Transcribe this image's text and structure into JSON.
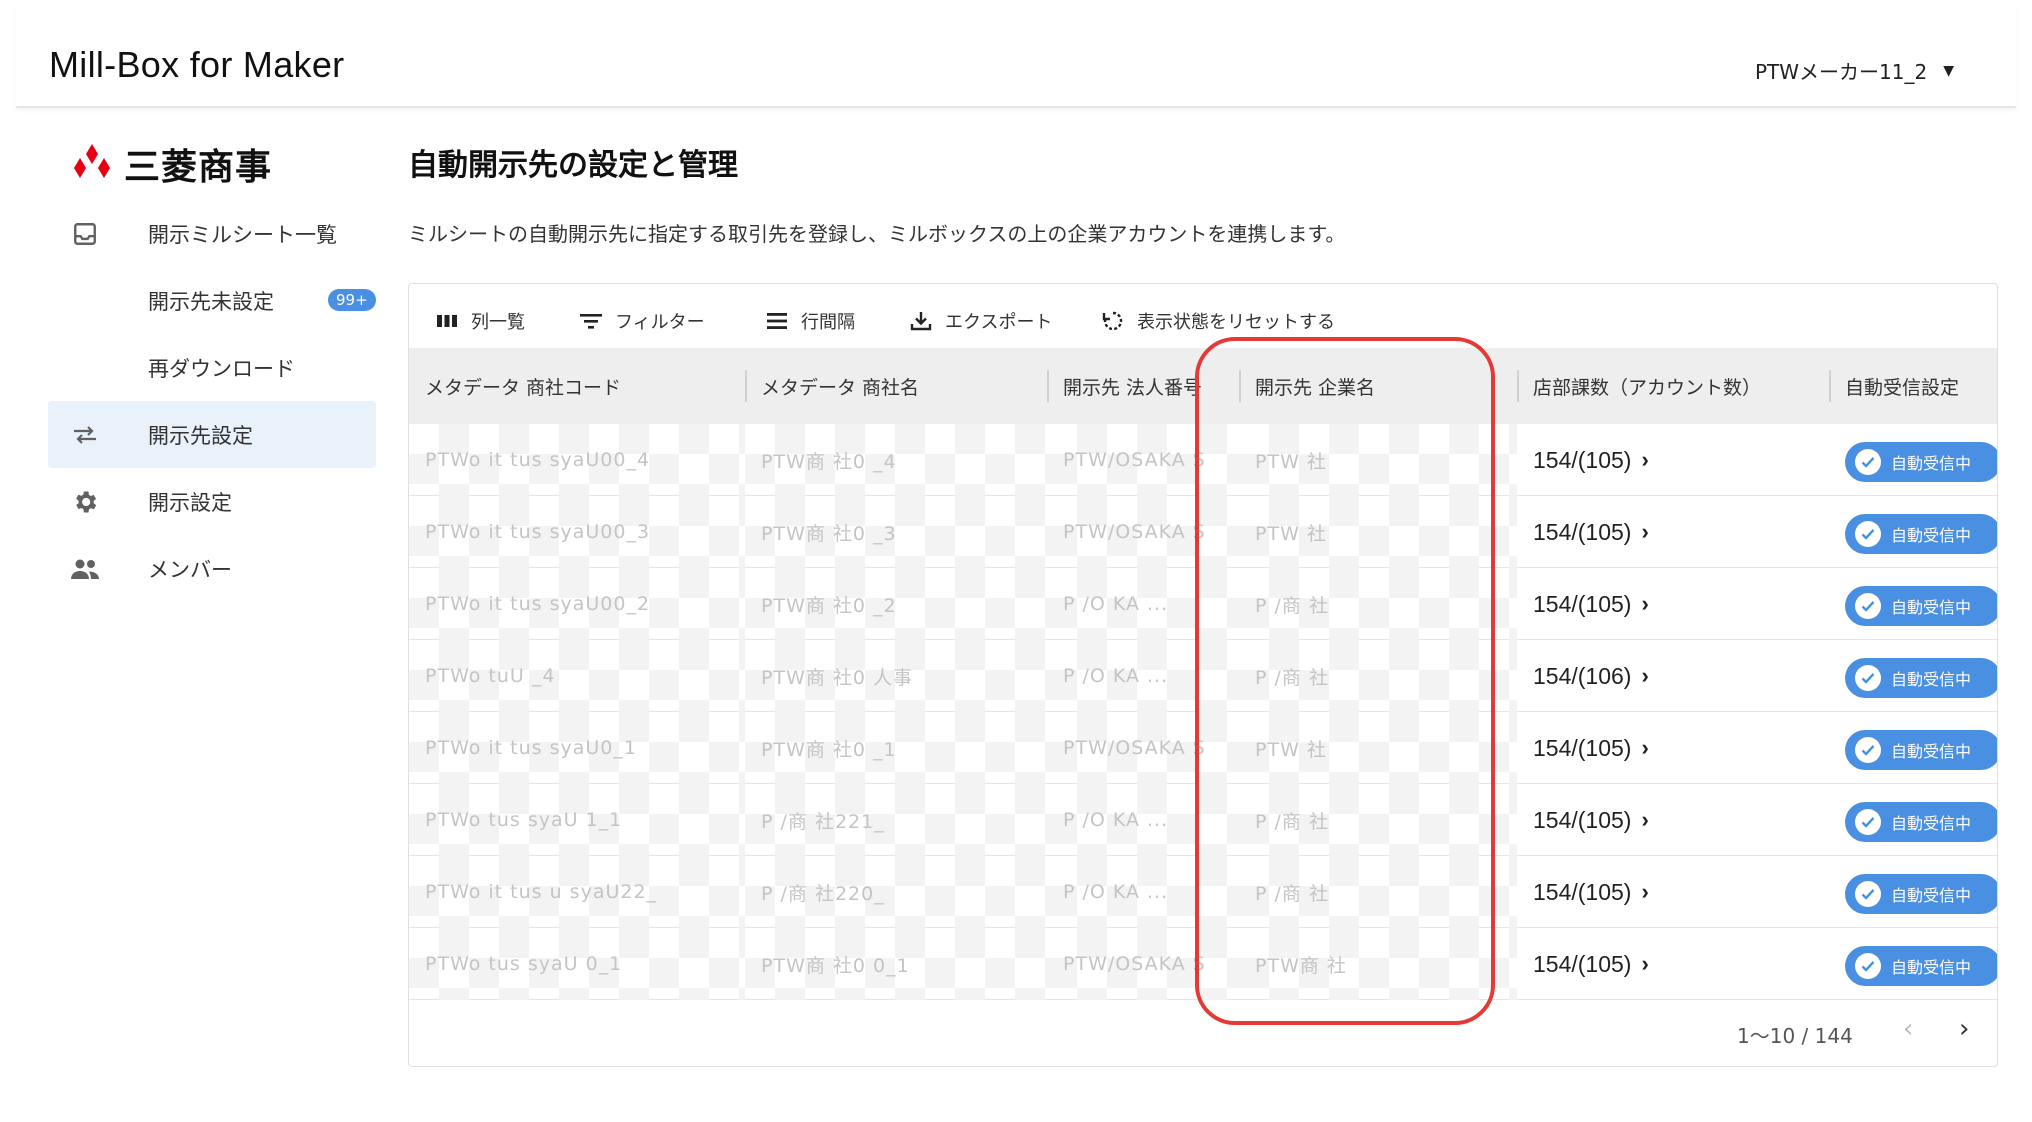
{
  "app": {
    "title": "Mill-Box for Maker",
    "account": "PTWメーカー11_2"
  },
  "sidebar": {
    "brand": "三菱商事",
    "items": [
      {
        "label": "開示ミルシート一覧",
        "icon": "inbox-icon"
      },
      {
        "label": "開示先未設定",
        "badge": "99+"
      },
      {
        "label": "再ダウンロード"
      },
      {
        "label": "開示先設定",
        "icon": "swap-arrows-icon",
        "active": true
      },
      {
        "label": "開示設定",
        "icon": "gear-icon"
      },
      {
        "label": "メンバー",
        "icon": "people-icon"
      }
    ]
  },
  "main": {
    "title": "自動開示先の設定と管理",
    "description": "ミルシートの自動開示先に指定する取引先を登録し、ミルボックスの上の企業アカウントを連携します。"
  },
  "toolbar": {
    "columns": "列一覧",
    "filter": "フィルター",
    "density": "行間隔",
    "export": "エクスポート",
    "reset": "表示状態をリセットする"
  },
  "table": {
    "headers": [
      "メタデータ 商社コード",
      "メタデータ 商社名",
      "開示先 法人番号",
      "開示先 企業名",
      "店部課数（アカウント数）",
      "自動受信設定"
    ],
    "rows": [
      {
        "code": "PTWo  it tus   syaU00_4",
        "name": "PTW商 社0  _4",
        "corp_no": "PTW/OSAKA S",
        "company": "PTW  社",
        "count": "154/(105)",
        "status": "自動受信中"
      },
      {
        "code": "PTWo  it tus   syaU00_3",
        "name": "PTW商 社0  _3",
        "corp_no": "PTW/OSAKA S",
        "company": "PTW  社",
        "count": "154/(105)",
        "status": "自動受信中"
      },
      {
        "code": "PTWo  it tus   syaU00_2",
        "name": "PTW商 社0  _2",
        "corp_no": "P  /O  KA ...",
        "company": "P  /商 社",
        "count": "154/(105)",
        "status": "自動受信中"
      },
      {
        "code": "PTWo    tuU   _4",
        "name": "PTW商 社0   人事",
        "corp_no": "P  /O  KA ...",
        "company": "P  /商 社",
        "count": "154/(106)",
        "status": "自動受信中"
      },
      {
        "code": "PTWo  it tus   syaU0_1",
        "name": "PTW商 社0  _1",
        "corp_no": "PTW/OSAKA S",
        "company": "PTW  社",
        "count": "154/(105)",
        "status": "自動受信中"
      },
      {
        "code": "PTWo    tus   syaU 1_1",
        "name": "P  /商 社221_",
        "corp_no": "P  /O  KA ...",
        "company": "P  /商 社",
        "count": "154/(105)",
        "status": "自動受信中"
      },
      {
        "code": "PTWo  it tus  u syaU22_",
        "name": "P  /商 社220_",
        "corp_no": "P  /O  KA ...",
        "company": "P  /商 社",
        "count": "154/(105)",
        "status": "自動受信中"
      },
      {
        "code": "PTWo    tus   syaU  0_1",
        "name": "PTW商 社0  0_1",
        "corp_no": "PTW/OSAKA S",
        "company": "PTW商 社",
        "count": "154/(105)",
        "status": "自動受信中"
      }
    ]
  },
  "pagination": {
    "range": "1〜10 / 144",
    "prev": "‹",
    "next": "›"
  },
  "colors": {
    "accent": "#4a90e2",
    "highlight": "#e53935",
    "active_nav": "#e9f1fb",
    "header_bg": "#eeeeee"
  }
}
